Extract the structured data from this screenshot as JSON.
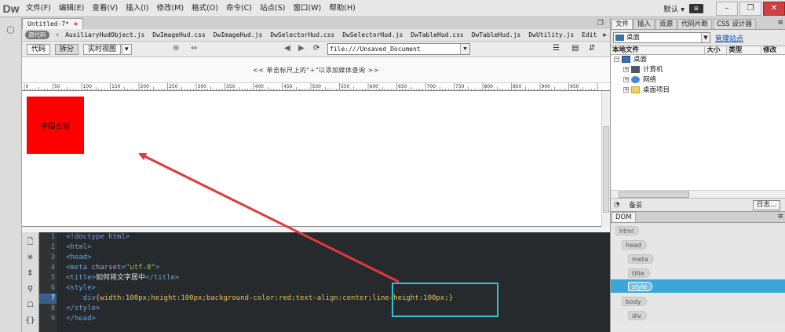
{
  "app": {
    "logo": "Dw",
    "menu": [
      "文件(F)",
      "编辑(E)",
      "查看(V)",
      "插入(I)",
      "修改(M)",
      "格式(O)",
      "命令(C)",
      "站点(S)",
      "窗口(W)",
      "帮助(H)"
    ],
    "workspace": "默认 ▾",
    "kb_badge": "⊞"
  },
  "document": {
    "tab_title": "Untitled-7*",
    "tab_close": "×",
    "source_badge": "源代码",
    "related_files": [
      "AuxiliaryHudObject.js",
      "DwImageHud.css",
      "DwImageHud.js",
      "DwSelectorHud.css",
      "DwSelectorHud.js",
      "DwTableHud.css",
      "DwTableHud.js",
      "DwUtility.js",
      "Edit"
    ],
    "views": {
      "code": "代码",
      "split": "拆分",
      "live": "实时视图"
    },
    "url": "file:///Unsaved_Document",
    "media_query_hint": "<< 单击标尺上的\"+\"以添加媒体查询 >>",
    "ruler_labels": [
      "0",
      "50",
      "100",
      "150",
      "200",
      "250",
      "300",
      "350",
      "400",
      "450",
      "500",
      "550",
      "600",
      "650",
      "700",
      "750",
      "800",
      "850",
      "900",
      "950"
    ],
    "red_box_text": "中国长城",
    "red_box_color": "#ff0000"
  },
  "code": {
    "line_numbers": [
      "1",
      "2",
      "3",
      "4",
      "5",
      "6",
      "7",
      "8",
      "9"
    ],
    "current_line": "7",
    "l1": "<!doctype html>",
    "l2": "<html>",
    "l3": "<head>",
    "l4_open": "<meta ",
    "l4_attr": "charset",
    "l4_eq": "=",
    "l4_val": "\"utf-8\"",
    "l4_close": ">",
    "l5_open": "<title>",
    "l5_text": "如何将文字居中",
    "l5_close": "</title>",
    "l6": "<style>",
    "l7_indent": "    ",
    "l7_sel": "div",
    "l7_rules": "{width:100px;height:100px;background-color:red;text-align:center;",
    "l7_highlight": "line-height:100px;}",
    "l8": "</style>",
    "l9": "</head>",
    "highlight_color": "#2ec4d6"
  },
  "files_panel": {
    "tabs": [
      "文件",
      "插入",
      "资源",
      "代码片断",
      "CSS 设计器"
    ],
    "site": "桌面",
    "manage_sites": "管理站点",
    "columns": {
      "local": "本地文件",
      "size": "大小",
      "type": "类型",
      "modified": "修改"
    },
    "tree": {
      "root": "桌面",
      "items": [
        "计算机",
        "网络",
        "桌面项目"
      ]
    },
    "status": "备妥",
    "log_button": "日志..."
  },
  "dom_panel": {
    "tab": "DOM",
    "nodes": [
      "html",
      "head",
      "meta",
      "title",
      "style",
      "body",
      "div"
    ],
    "selected": "style"
  }
}
